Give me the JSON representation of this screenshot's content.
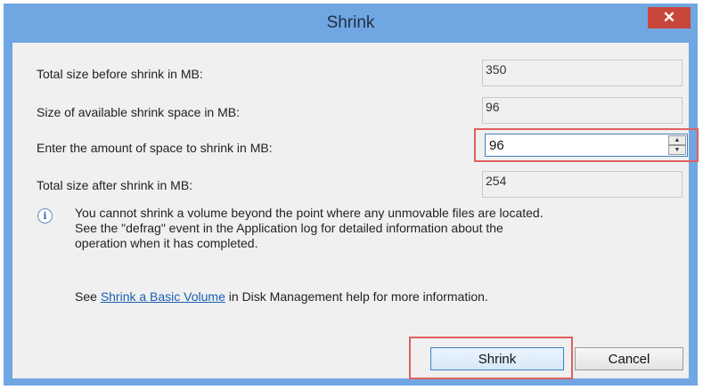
{
  "window": {
    "title": "Shrink",
    "close_glyph": "✕"
  },
  "fields": {
    "total_before_label": "Total size before shrink in MB:",
    "total_before_value": "350",
    "available_label": "Size of available shrink space in MB:",
    "available_value": "96",
    "amount_label": "Enter the amount of space to shrink in MB:",
    "amount_value": "96",
    "total_after_label": "Total size after shrink in MB:",
    "total_after_value": "254"
  },
  "info": {
    "icon": "info-icon",
    "text_line1": "You cannot shrink a volume beyond the point where any unmovable files are located.",
    "text_line2": "See the \"defrag\" event in the Application log for detailed information about the",
    "text_line3": "operation when it has completed."
  },
  "help": {
    "prefix": "See ",
    "link_text": "Shrink a Basic Volume",
    "suffix": " in Disk Management help for more information."
  },
  "buttons": {
    "shrink_label": "Shrink",
    "cancel_label": "Cancel"
  },
  "colors": {
    "frame": "#70a6e1",
    "close": "#c9463b",
    "highlight": "#e06060",
    "link": "#1a5fb4"
  }
}
